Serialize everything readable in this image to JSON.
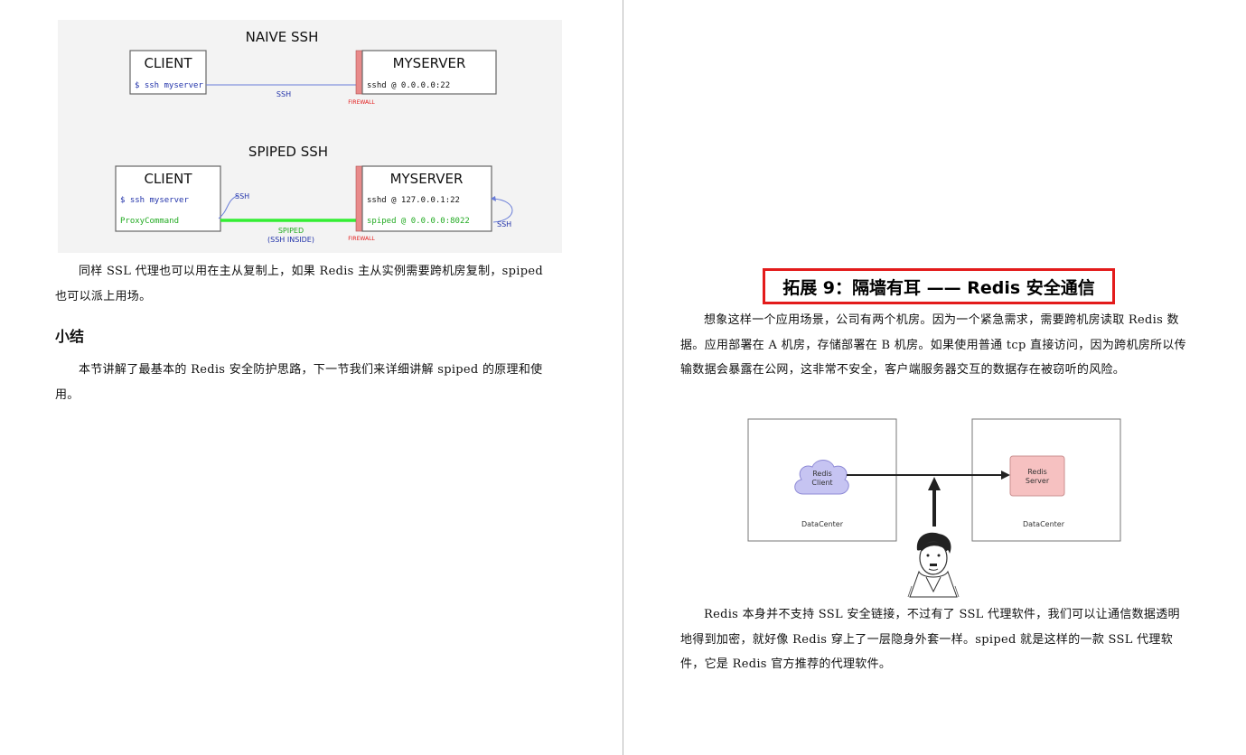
{
  "left_page": {
    "figure": {
      "naive": {
        "title": "NAIVE SSH",
        "client_label": "CLIENT",
        "client_cmd": "$ ssh myserver",
        "server_label": "MYSERVER",
        "server_line": "sshd @ 0.0.0.0:22",
        "arrow_label": "SSH",
        "firewall_label": "FIREWALL"
      },
      "spiped": {
        "title": "SPIPED SSH",
        "client_label": "CLIENT",
        "client_cmd": "$ ssh myserver",
        "client_proxy": "ProxyCommand",
        "server_label": "MYSERVER",
        "server_line1": "sshd @ 127.0.0.1:22",
        "server_line2": "spiped @ 0.0.0.0:8022",
        "client_loop_label": "SSH",
        "server_loop_label": "SSH",
        "tunnel_label1": "SPIPED",
        "tunnel_label2": "(SSH INSIDE)",
        "firewall_label": "FIREWALL"
      }
    },
    "para1": "同样 SSL 代理也可以用在主从复制上，如果 Redis 主从实例需要跨机房复制，spiped 也可以派上用场。",
    "heading": "小结",
    "para2": "本节讲解了最基本的 Redis 安全防护思路，下一节我们来详细讲解 spiped 的原理和使用。"
  },
  "right_page": {
    "title": "拓展 9：隔墙有耳 —— Redis 安全通信",
    "para1": "想象这样一个应用场景，公司有两个机房。因为一个紧急需求，需要跨机房读取 Redis 数据。应用部署在 A 机房，存储部署在 B 机房。如果使用普通 tcp 直接访问，因为跨机房所以传输数据会暴露在公网，这非常不安全，客户端服务器交互的数据存在被窃听的风险。",
    "diagram": {
      "client_line1": "Redis",
      "client_line2": "Client",
      "server_line1": "Redis",
      "server_line2": "Server",
      "left_dc": "DataCenter",
      "right_dc": "DataCenter"
    },
    "para2": "Redis 本身并不支持 SSL 安全链接，不过有了 SSL 代理软件，我们可以让通信数据透明地得到加密，就好像 Redis 穿上了一层隐身外套一样。spiped 就是这样的一款 SSL 代理软件，它是 Redis 官方推荐的代理软件。"
  },
  "colors": {
    "firewall": "#e88a8a",
    "client_cmd": "#2233aa",
    "proxy_green": "#22aa22",
    "tunnel_green": "#33ee33",
    "title_border": "#e31b1b",
    "cloud": "#c6c4f2",
    "server_box": "#f6c1c1"
  }
}
